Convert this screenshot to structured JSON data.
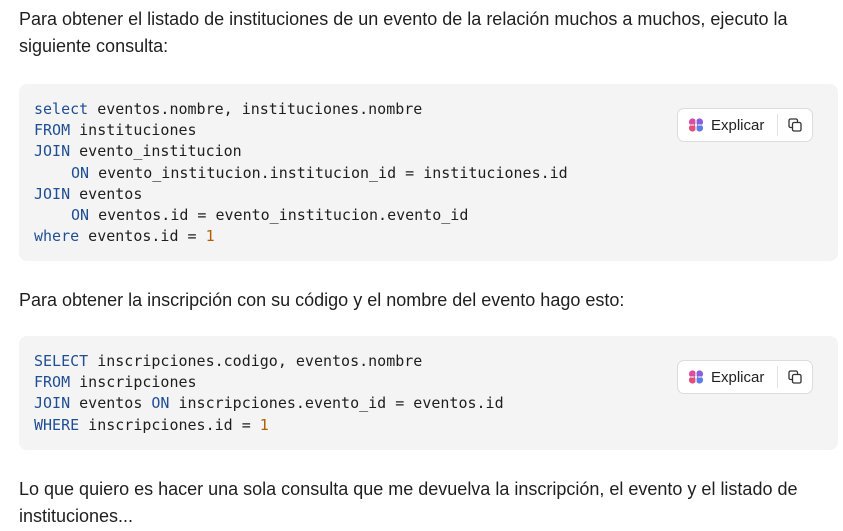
{
  "messages": {
    "intro": "Para obtener el listado de instituciones de un evento de la relación muchos a muchos, ejecuto la siguiente consulta:",
    "middle": "Para obtener la inscripción con su código y el nombre del evento hago esto:",
    "outro": "Lo que quiero es hacer una sola consulta que me devuelva la inscripción, el evento y el listado de instituciones..."
  },
  "code1": {
    "l1_kw": "select",
    "l1_rest": " eventos.nombre, instituciones.nombre",
    "l2_kw": "FROM",
    "l2_rest": " instituciones",
    "l3_kw": "JOIN",
    "l3_rest": " evento_institucion",
    "l4_kw": "ON",
    "l4_rest": " evento_institucion.institucion_id = instituciones.id",
    "l5_kw": "JOIN",
    "l5_rest": " eventos",
    "l6_kw": "ON",
    "l6_rest": " eventos.id = evento_institucion.evento_id",
    "l7_kw": "where",
    "l7_rest": " eventos.id = ",
    "l7_num": "1"
  },
  "code2": {
    "l1_kw": "SELECT",
    "l1_rest": " inscripciones.codigo, eventos.nombre",
    "l2_kw": "FROM",
    "l2_rest": " inscripciones",
    "l3_kw": "JOIN",
    "l3_mid": " eventos ",
    "l3_kw2": "ON",
    "l3_rest": " inscripciones.evento_id = eventos.id",
    "l4_kw": "WHERE",
    "l4_rest": " inscripciones.id = ",
    "l4_num": "1"
  },
  "actions": {
    "explain_label": "Explicar",
    "explain_icon": "brain-icon",
    "copy_icon": "copy-icon"
  },
  "colors": {
    "keyword": "#1f4e94",
    "number": "#b25c00",
    "code_bg": "#f4f4f4"
  }
}
